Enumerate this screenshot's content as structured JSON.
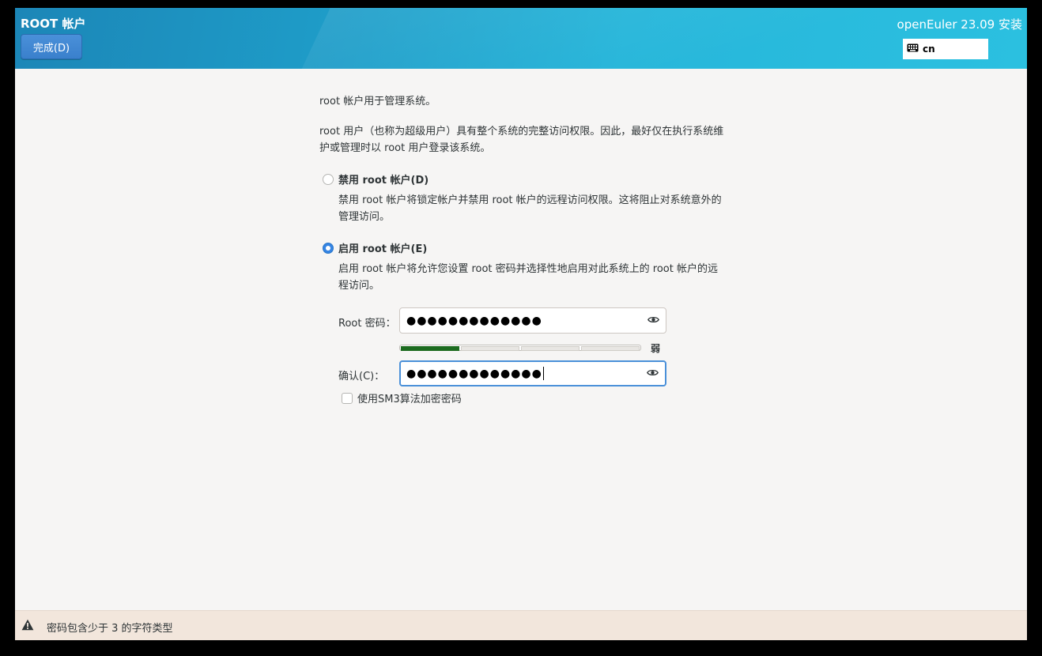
{
  "header": {
    "title": "ROOT 帐户",
    "done_label": "完成(D)",
    "product": "openEuler 23.09 安装",
    "keyboard_layout": "cn"
  },
  "intro": {
    "line1": "root 帐户用于管理系统。",
    "line2": "root 用户（也称为超级用户）具有整个系统的完整访问权限。因此，最好仅在执行系统维护或管理时以 root 用户登录该系统。"
  },
  "options": {
    "disable": {
      "label": "禁用 root 帐户(D)",
      "description": "禁用 root 帐户将锁定帐户并禁用 root 帐户的远程访问权限。这将阻止对系统意外的管理访问。",
      "selected": false
    },
    "enable": {
      "label": "启用 root 帐户(E)",
      "description": "启用 root 帐户将允许您设置 root 密码并选择性地启用对此系统上的 root 帐户的远程访问。",
      "selected": true
    }
  },
  "password": {
    "label": "Root 密码：",
    "value": "●●●●●●●●●●●●●"
  },
  "confirm": {
    "label": "确认(C)：",
    "value": "●●●●●●●●●●●●●"
  },
  "strength": {
    "label": "弱",
    "level": 0.25,
    "color": "#1c6b1f"
  },
  "sm3_checkbox": {
    "label": "使用SM3算法加密密码",
    "checked": false
  },
  "status": {
    "icon": "warning-icon",
    "message": "密码包含少于 3 的字符类型"
  }
}
